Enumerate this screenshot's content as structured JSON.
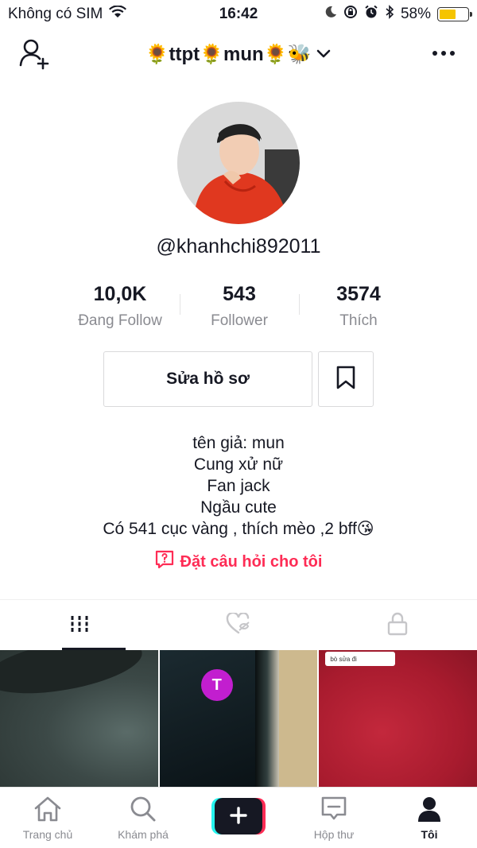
{
  "status_bar": {
    "carrier": "Không có SIM",
    "time": "16:42",
    "battery_percent": "58%",
    "battery_level": 0.58
  },
  "header": {
    "account_name": "🌻ttpt🌻mun🌻🐝"
  },
  "profile": {
    "username": "@khanhchi892011",
    "stats": [
      {
        "value": "10,0K",
        "label": "Đang Follow"
      },
      {
        "value": "543",
        "label": "Follower"
      },
      {
        "value": "3574",
        "label": "Thích"
      }
    ],
    "edit_button": "Sửa hồ sơ",
    "bio": [
      "tên giả: mun",
      "Cung xử nữ",
      "Fan jack",
      "Ngầu cute",
      "Có 541 cục vàng , thích mèo ,2 bff😘"
    ],
    "ask_link": "Đặt câu hỏi cho tôi"
  },
  "videos": {
    "thumb2_badge": "T",
    "thumb3_comment": "bò sửa đi"
  },
  "bottom_nav": [
    {
      "label": "Trang chủ",
      "icon": "home-icon"
    },
    {
      "label": "Khám phá",
      "icon": "search-icon"
    },
    {
      "label": "",
      "icon": "plus-icon"
    },
    {
      "label": "Hộp thư",
      "icon": "inbox-icon"
    },
    {
      "label": "Tôi",
      "icon": "profile-icon"
    }
  ],
  "colors": {
    "accent": "#fe2c55",
    "cyan": "#25f4ee",
    "text": "#161823",
    "muted": "#8a8b91"
  }
}
